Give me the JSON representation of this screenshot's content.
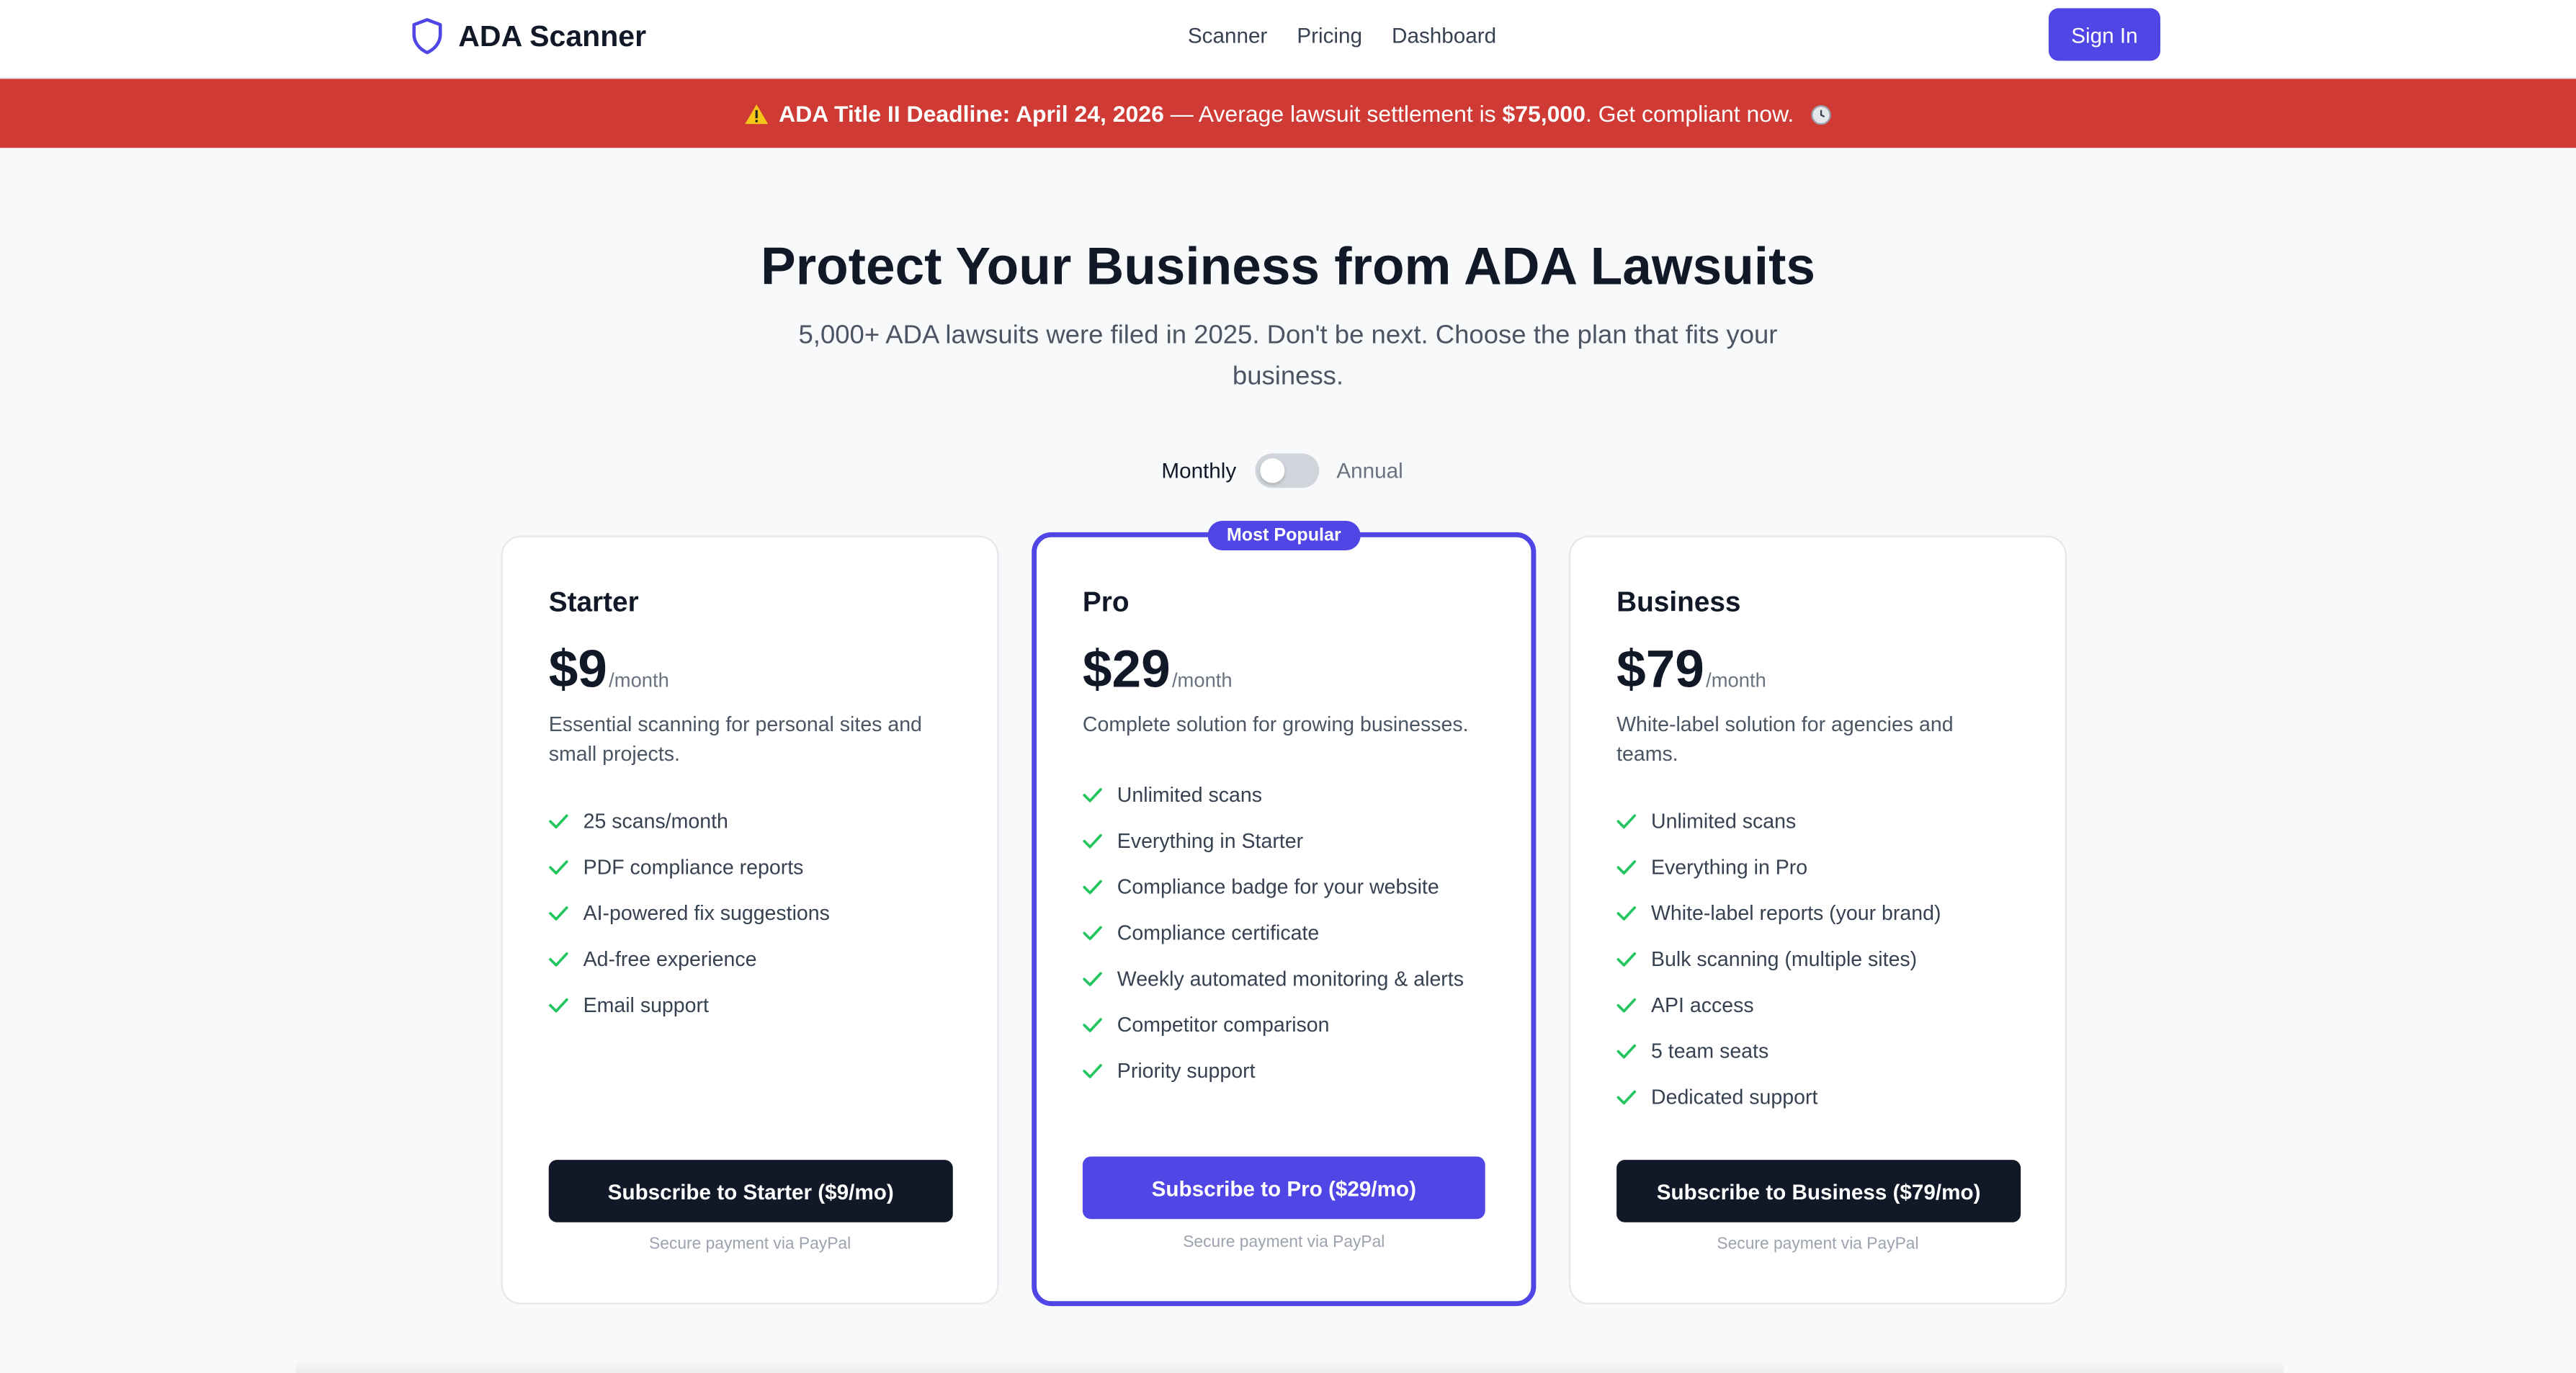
{
  "nav": {
    "brand": "ADA Scanner",
    "links": [
      "Scanner",
      "Pricing",
      "Dashboard"
    ],
    "signin": "Sign In"
  },
  "banner": {
    "deadline": "ADA Title II Deadline: April 24, 2026",
    "middle": " — Average lawsuit settlement is ",
    "amount": "$75,000",
    "tail": ". Get compliant now."
  },
  "hero": {
    "title": "Protect Your Business from ADA Lawsuits",
    "subtitle": "5,000+ ADA lawsuits were filed in 2025. Don't be next. Choose the plan that fits your business."
  },
  "billing_toggle": {
    "monthly": "Monthly",
    "annual": "Annual",
    "annual_selected": false
  },
  "plans": [
    {
      "name": "Starter",
      "price": "$9",
      "per": "/month",
      "description": "Essential scanning for personal sites and small projects.",
      "features": [
        "25 scans/month",
        "PDF compliance reports",
        "AI-powered fix suggestions",
        "Ad-free experience",
        "Email support"
      ],
      "cta": "Subscribe to Starter ($9/mo)",
      "secure": "Secure payment via PayPal"
    },
    {
      "name": "Pro",
      "badge": "Most Popular",
      "price": "$29",
      "per": "/month",
      "description": "Complete solution for growing businesses.",
      "features": [
        "Unlimited scans",
        "Everything in Starter",
        "Compliance badge for your website",
        "Compliance certificate",
        "Weekly automated monitoring & alerts",
        "Competitor comparison",
        "Priority support"
      ],
      "cta": "Subscribe to Pro ($29/mo)",
      "secure": "Secure payment via PayPal"
    },
    {
      "name": "Business",
      "price": "$79",
      "per": "/month",
      "description": "White-label solution for agencies and teams.",
      "features": [
        "Unlimited scans",
        "Everything in Pro",
        "White-label reports (your brand)",
        "Bulk scanning (multiple sites)",
        "API access",
        "5 team seats",
        "Dedicated support"
      ],
      "cta": "Subscribe to Business ($79/mo)",
      "secure": "Secure payment via PayPal"
    }
  ],
  "colors": {
    "accent": "#4f46e5",
    "banner": "#cf3a34",
    "dark": "#111827",
    "check": "#22c55e"
  },
  "icons": {
    "brand": "shield-icon",
    "banner_left": "warning-icon",
    "banner_right": "timer-icon",
    "feature": "check-icon"
  }
}
